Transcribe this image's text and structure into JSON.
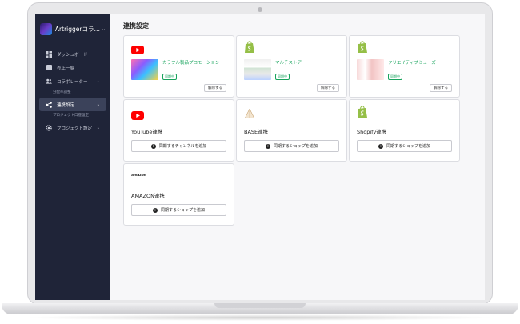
{
  "sidebar": {
    "brand": "Artriggerコラ…",
    "items": [
      {
        "label": "ダッシュボード",
        "icon": "dashboard-icon"
      },
      {
        "label": "売上一覧",
        "icon": "sales-list-icon"
      },
      {
        "label": "コラボレーター",
        "icon": "collaborators-icon"
      },
      {
        "label": "分配率調整"
      },
      {
        "label": "連携設定",
        "icon": "share-icon",
        "active": true
      },
      {
        "label": "プロジェクト口座設定"
      },
      {
        "label": "プロジェクト設定",
        "icon": "gear-icon"
      }
    ]
  },
  "main": {
    "title": "連携設定",
    "linked": [
      {
        "service_icon": "youtube-icon",
        "account": "カラフル製品プロモーション",
        "badge": "同期中",
        "button": "解除する"
      },
      {
        "service_icon": "shopify-icon",
        "account": "マルチストア",
        "badge": "同期中",
        "button": "解除する"
      },
      {
        "service_icon": "shopify-icon",
        "account": "クリエイティブミューズ",
        "badge": "同期中",
        "button": "解除する"
      }
    ],
    "services": [
      {
        "service_icon": "youtube-icon",
        "title": "YouTube連携",
        "button": "同期するチャンネルを追加"
      },
      {
        "service_icon": "base-icon",
        "title": "BASE連携",
        "button": "同期するショップを追加"
      },
      {
        "service_icon": "shopify-icon",
        "title": "Shopify連携",
        "button": "同期するショップを追加"
      },
      {
        "service_icon": "amazon-logo",
        "logo_text": "amazon",
        "title": "AMAZON連携",
        "button": "同期するショップを追加"
      }
    ]
  },
  "colors": {
    "sidebar_bg": "#1f2438",
    "accent_green": "#17a35c",
    "youtube_red": "#ff0000",
    "shopify_green": "#95bf47"
  }
}
